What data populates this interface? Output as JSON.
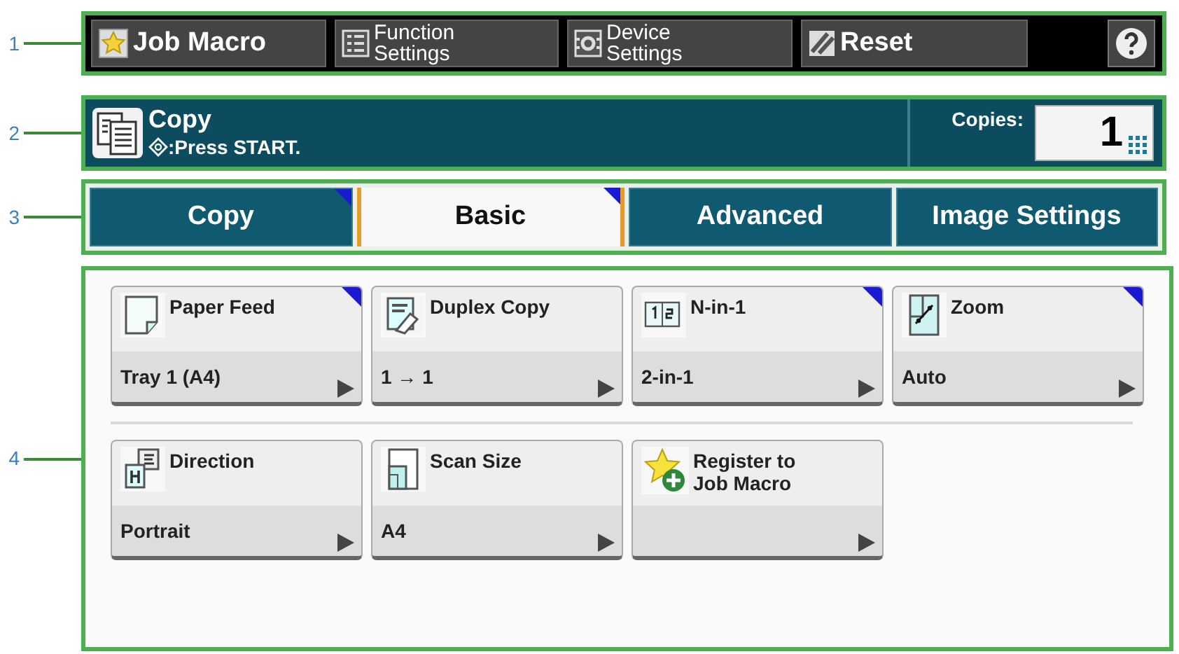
{
  "callouts": [
    {
      "label": "1"
    },
    {
      "label": "2"
    },
    {
      "label": "3"
    },
    {
      "label": "4"
    }
  ],
  "toolbar": {
    "buttons": [
      {
        "label": "Job Macro"
      },
      {
        "label": "Function Settings"
      },
      {
        "label": "Device Settings"
      },
      {
        "label": "Reset"
      }
    ]
  },
  "status": {
    "title": "Copy",
    "message": ":Press START.",
    "copies_label": "Copies:",
    "copies_value": "1"
  },
  "tabs": [
    {
      "label": "Copy",
      "selected": false,
      "changed": true
    },
    {
      "label": "Basic",
      "selected": true,
      "changed": true
    },
    {
      "label": "Advanced",
      "selected": false,
      "changed": false
    },
    {
      "label": "Image Settings",
      "selected": false,
      "changed": false
    }
  ],
  "tile_rows": [
    [
      {
        "title": "Paper Feed",
        "value": "Tray 1 (A4)",
        "changed": true
      },
      {
        "title": "Duplex Copy",
        "value": "1 → 1",
        "changed": false
      },
      {
        "title": "N-in-1",
        "value": "2-in-1",
        "changed": true
      },
      {
        "title": "Zoom",
        "value": "Auto",
        "changed": true
      }
    ],
    [
      {
        "title": "Direction",
        "value": "Portrait",
        "changed": false
      },
      {
        "title": "Scan Size",
        "value": "A4",
        "changed": false
      },
      {
        "title": "Register to Job Macro",
        "changed": false
      }
    ]
  ]
}
